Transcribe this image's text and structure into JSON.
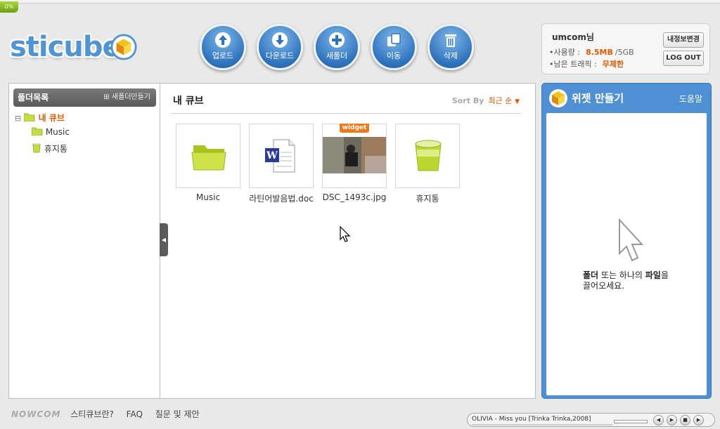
{
  "progress": {
    "label": "0%",
    "value": 0
  },
  "logo": {
    "text": "sticube"
  },
  "toolbar": {
    "items": [
      {
        "name": "upload",
        "label": "업로드",
        "icon": "arrow-up-icon"
      },
      {
        "name": "download",
        "label": "다운로드",
        "icon": "arrow-down-icon"
      },
      {
        "name": "new-folder",
        "label": "새폴더",
        "icon": "plus-icon"
      },
      {
        "name": "move",
        "label": "이동",
        "icon": "move-icon"
      },
      {
        "name": "delete",
        "label": "삭제",
        "icon": "trash-icon"
      }
    ]
  },
  "user": {
    "name": "umcom님",
    "usage_label": "•사용량 :",
    "usage_value": "8.5MB",
    "usage_total": "/5GB",
    "traffic_label": "•남은 트래픽 :",
    "traffic_value": "무제한",
    "edit_button": "내정보변경",
    "logout_button": "LOG OUT"
  },
  "sidebar": {
    "title": "폴더목록",
    "new_folder": "새폴더만들기",
    "tree": [
      {
        "label": "내 큐브",
        "root": true,
        "expand": "⊟"
      },
      {
        "label": "Music"
      },
      {
        "label": "휴지통"
      }
    ]
  },
  "main": {
    "title": "내 큐브",
    "sort_label": "Sort By",
    "sort_value": "최근 순",
    "files": [
      {
        "name": "Music",
        "type": "folder"
      },
      {
        "name": "라틴어발음법.doc",
        "type": "doc"
      },
      {
        "name": "DSC_1493c.jpg",
        "type": "image",
        "tag": "widget"
      },
      {
        "name": "휴지통",
        "type": "trash"
      }
    ]
  },
  "widget_panel": {
    "title": "위젯 만들기",
    "help": "도움말",
    "drop_text_1a": "폴더",
    "drop_text_1b": " 또는 하나의 ",
    "drop_text_1c": "파일",
    "drop_text_1d": "을",
    "drop_text_2": "끌어오세요."
  },
  "footer": {
    "brand": "NOWCOM",
    "links": [
      "스티큐브란?",
      "FAQ",
      "질문 및 제안"
    ]
  },
  "player": {
    "song": "OLIVIA - Miss you [Trinka Trinka,2008]"
  },
  "colors": {
    "accent": "#e15a00",
    "brand_blue": "#4f8fd4",
    "folder_green": "#b7d22f"
  }
}
